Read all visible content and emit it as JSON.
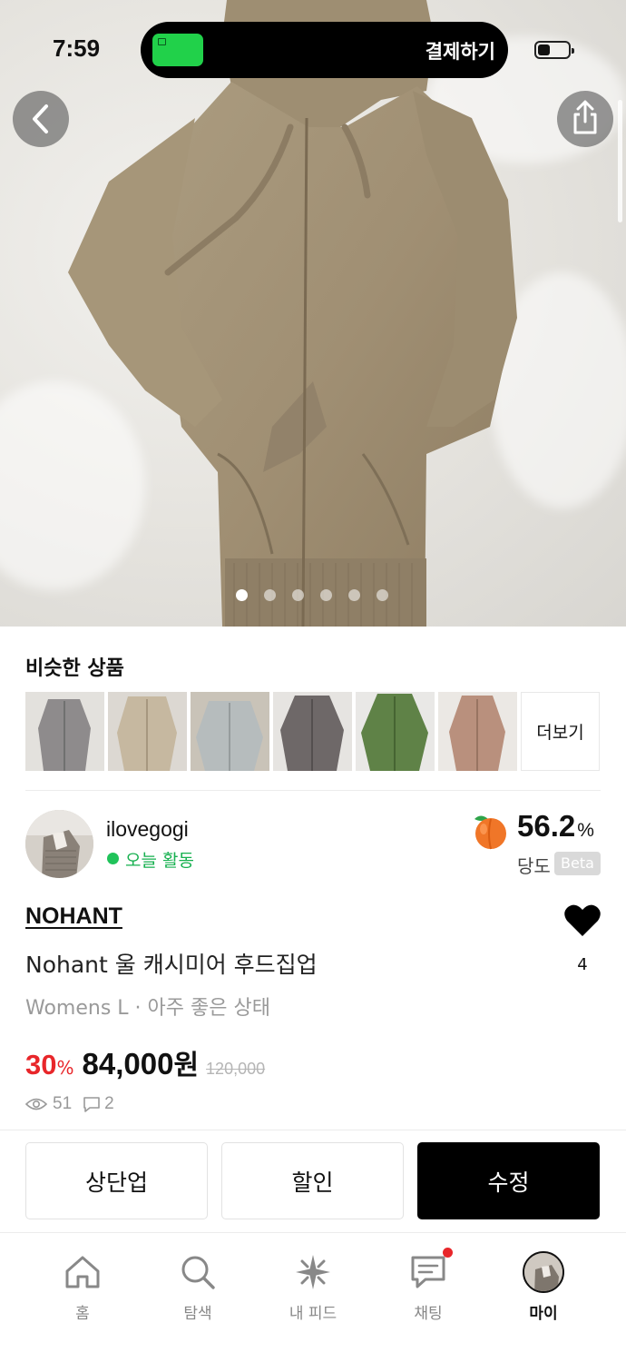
{
  "status_bar": {
    "time": "7:59",
    "live_activity_label": "결제하기",
    "battery_level": 0.25
  },
  "hero": {
    "image_count": 6,
    "active_index": 0
  },
  "similar": {
    "title": "비슷한 상품",
    "more_label": "더보기",
    "thumbnails": [
      {
        "color": "#8e8b8c"
      },
      {
        "color": "#c6b8a0"
      },
      {
        "color": "#b6bcbd"
      },
      {
        "color": "#6e6868"
      },
      {
        "color": "#5f8247"
      },
      {
        "color": "#b9907d"
      }
    ]
  },
  "seller": {
    "name": "ilovegogi",
    "activity": "오늘 활동",
    "score": "56.2",
    "score_unit": "%",
    "score_label": "당도",
    "badge": "Beta"
  },
  "product": {
    "brand": "NOHANT",
    "name": "Nohant 울 캐시미어 후드집업",
    "details": "Womens L · 아주 좋은 상태",
    "discount": "30",
    "discount_unit": "%",
    "price": "84,000",
    "price_unit": "원",
    "original_price": "120,000",
    "likes": "4",
    "views": "51",
    "comments": "2"
  },
  "actions": {
    "bump": "상단업",
    "discount": "할인",
    "edit": "수정"
  },
  "tabbar": {
    "home": "홈",
    "search": "탐색",
    "feed": "내 피드",
    "chat": "채팅",
    "my": "마이"
  },
  "colors": {
    "accent_red": "#e8262a",
    "active_green": "#20c35a",
    "pay_green": "#21d14a"
  }
}
